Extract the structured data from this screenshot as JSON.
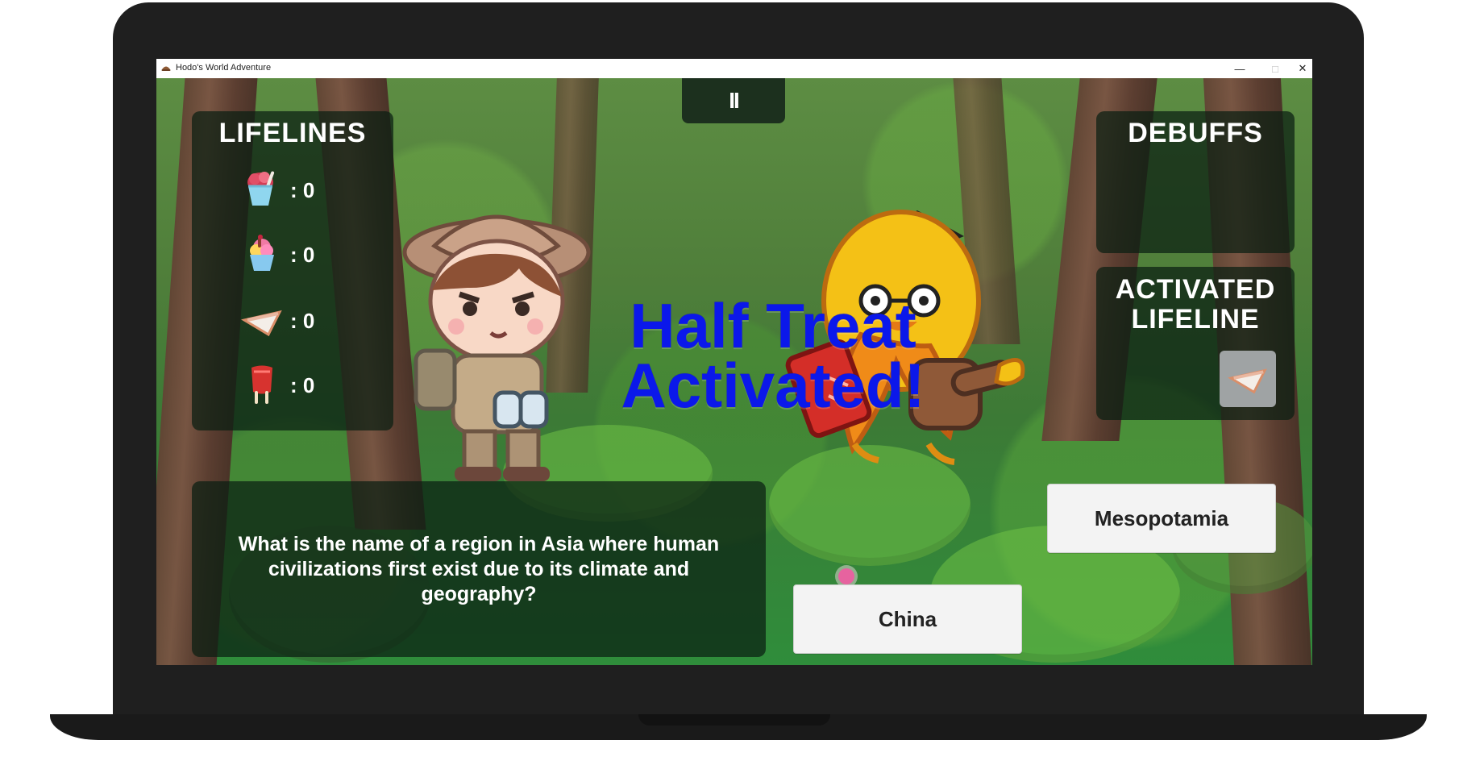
{
  "window": {
    "title": "Hodo's World Adventure",
    "controls": {
      "minimize": "—",
      "maximize": "□",
      "close": "✕"
    }
  },
  "game": {
    "pause_symbol": "II",
    "lifelines": {
      "title": "LIFELINES",
      "items": [
        {
          "icon": "ice-cream-cup-icon",
          "count": ": 0"
        },
        {
          "icon": "sundae-icon",
          "count": ": 0"
        },
        {
          "icon": "pie-slice-icon",
          "count": ": 0"
        },
        {
          "icon": "popsicle-icon",
          "count": ": 0"
        }
      ]
    },
    "debuffs": {
      "title": "DEBUFFS"
    },
    "activated_lifeline": {
      "title_line_1": "ACTIVATED",
      "title_line_2": "LIFELINE",
      "icon": "pie-slice-icon"
    },
    "banner": {
      "line_1": "Half Treat",
      "line_2": "Activated!"
    },
    "question": {
      "text": "What is the name of a region in Asia where human civilizations first exist due to its climate and geography?"
    },
    "answers": [
      {
        "label": "Mesopotamia"
      },
      {
        "label": "China"
      }
    ],
    "colors": {
      "banner": "#0b18ea",
      "panel": "#0a1e12",
      "answer_button": "#f3f3f3",
      "background": "#4f7e3a"
    }
  }
}
